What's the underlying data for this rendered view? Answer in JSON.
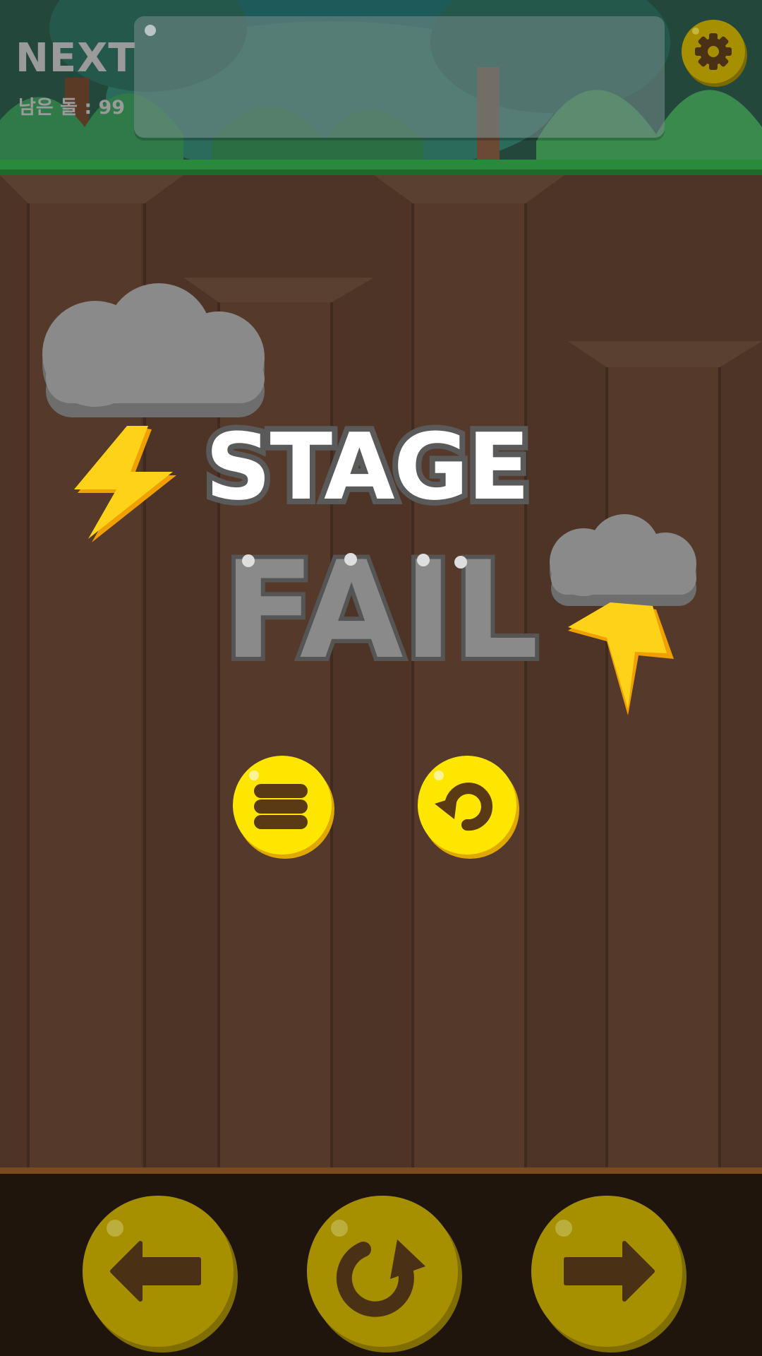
{
  "header": {
    "next_label": "NEXT",
    "remaining_stones_label": "남은 돌 : 99"
  },
  "result": {
    "line1": "STAGE",
    "line2": "FAIL"
  },
  "icons": {
    "settings": "gear-icon",
    "menu": "menu-icon",
    "retry": "retry-icon",
    "move_left": "arrow-left-icon",
    "rotate": "rotate-icon",
    "move_right": "arrow-right-icon",
    "storm": "storm-cloud-icon"
  },
  "colors": {
    "accent_yellow": "#ffe600",
    "control_olive": "#a79000",
    "fail_gray": "#888888",
    "dirt_brown": "#4d3426"
  }
}
